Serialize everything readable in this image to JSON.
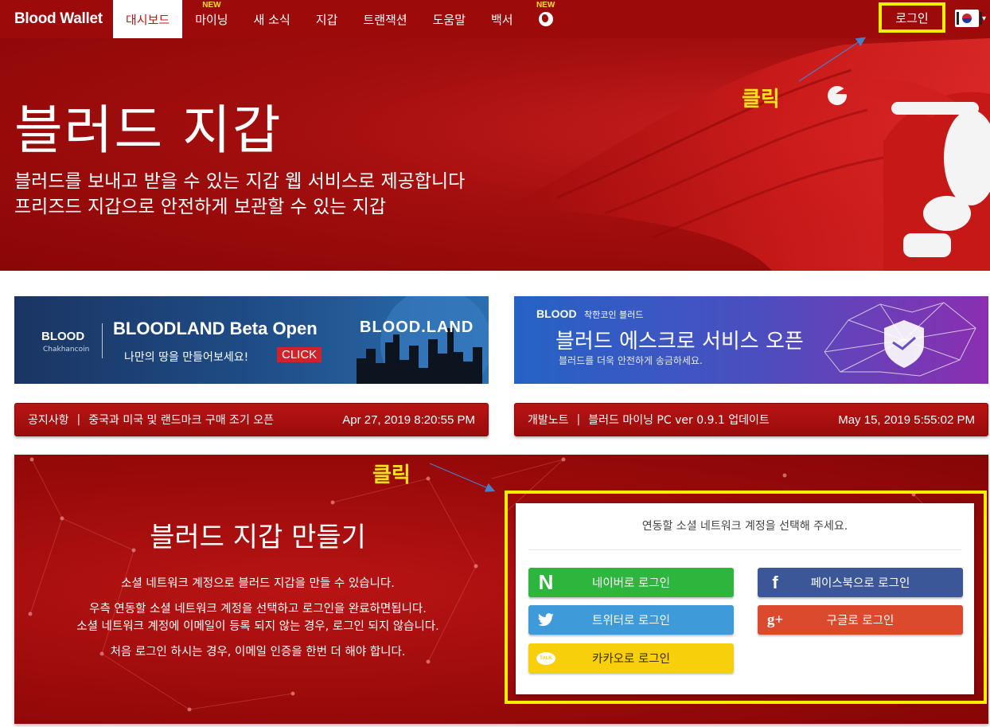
{
  "brand": "Blood Wallet",
  "nav": {
    "items": [
      {
        "label": "대시보드",
        "new": ""
      },
      {
        "label": "마이닝",
        "new": "NEW"
      },
      {
        "label": "새 소식",
        "new": ""
      },
      {
        "label": "지갑",
        "new": ""
      },
      {
        "label": "트랜잭션",
        "new": ""
      },
      {
        "label": "도움말",
        "new": ""
      },
      {
        "label": "백서",
        "new": ""
      }
    ],
    "globe_badge": "NEW",
    "globe_icon": "globe-icon",
    "login": "로그인",
    "caret": "▾"
  },
  "hero": {
    "title": "블러드 지갑",
    "line1": "블러드를 보내고 받을 수 있는 지갑 웹 서비스로 제공합니다",
    "line2": "프리즈드 지갑으로 안전하게 보관할 수 있는 지갑"
  },
  "annotations": {
    "click_top": "클릭",
    "click_bottom": "클릭"
  },
  "banners": {
    "left": {
      "logo": "BLOOD",
      "logo_sub": "Chakhancoin",
      "title": "BLOODLAND Beta Open",
      "desc": "나만의 땅을 만들어보세요!",
      "click": "CLICK",
      "land": "BLOOD.LAND"
    },
    "right": {
      "logo": "BLOOD",
      "logo_sub": "착한코인 블러드",
      "title": "블러드 에스크로 서비스 오픈",
      "desc": "블러드를 더욱 안전하게 송금하세요."
    }
  },
  "notices": [
    {
      "category": "공지사항",
      "sep": "|",
      "text": "중국과 미국 및 랜드마크 구매 조기 오픈",
      "date": "Apr 27, 2019 8:20:55 PM"
    },
    {
      "category": "개발노트",
      "sep": "|",
      "text": "블러드 마이닝 PC ver 0.9.1 업데이트",
      "date": "May 15, 2019 5:55:02 PM"
    }
  ],
  "create": {
    "title": "블러드 지갑 만들기",
    "line1": "소셜 네트워크 계정으로 블러드 지갑을 만들 수 있습니다.",
    "line2": "우측 연동할 소셜 네트워크 계정을 선택하고 로그인을 완료하면됩니다.",
    "line3": "소셜 네트워크 계정에 이메일이 등록 되지 않는 경우, 로그인 되지 않습니다.",
    "line4": "처음 로그인 하시는 경우, 이메일 인증을 한번 더 해야 합니다."
  },
  "social": {
    "prompt": "연동할 소셜 네트워크 계정을 선택해 주세요.",
    "naver": {
      "label": "네이버로 로그인",
      "icon": "N",
      "color": "#2db53d"
    },
    "facebook": {
      "label": "페이스북으로 로그인",
      "icon": "f",
      "color": "#3b5797"
    },
    "twitter": {
      "label": "트위터로 로그인",
      "icon": "twitter-bird-icon",
      "color": "#3e9ad8"
    },
    "google": {
      "label": "구글로 로그인",
      "icon": "g+",
      "color": "#db4a2c"
    },
    "kakao": {
      "label": "카카오로 로그인",
      "icon": "TALK",
      "color": "#f7cf0b"
    }
  },
  "colors": {
    "brand_red": "#9c0a0a",
    "highlight_yellow": "#f6f000",
    "annotation_yellow": "#ffe31a"
  }
}
